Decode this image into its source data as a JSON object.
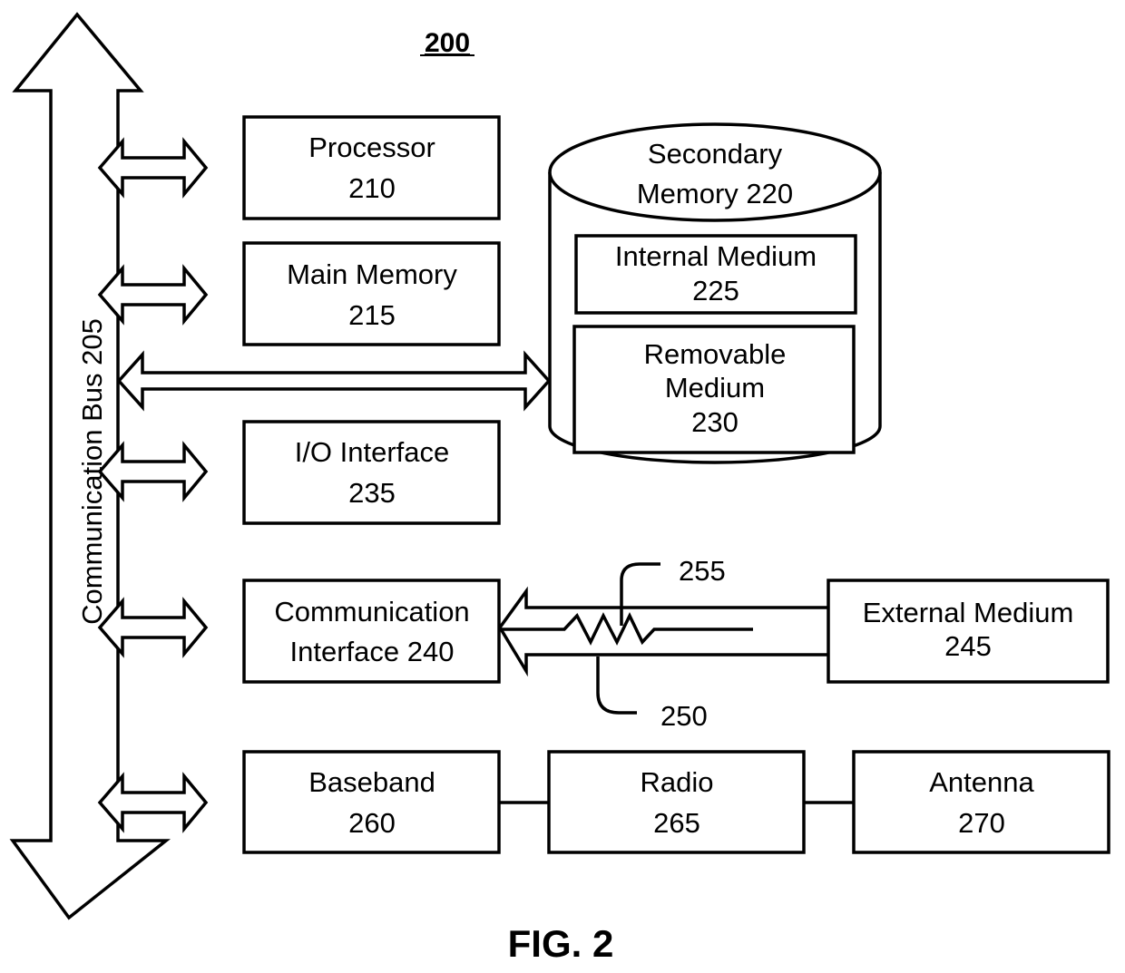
{
  "figure": {
    "number_label": "200",
    "caption": "FIG. 2"
  },
  "bus": {
    "label": "Communication Bus 205"
  },
  "blocks": {
    "processor": [
      "Processor",
      "210"
    ],
    "main_memory": [
      "Main Memory",
      "215"
    ],
    "io_interface": [
      "I/O Interface",
      "235"
    ],
    "comm_interface": [
      "Communication",
      "Interface 240"
    ],
    "baseband": [
      "Baseband",
      "260"
    ],
    "radio": [
      "Radio",
      "265"
    ],
    "antenna": [
      "Antenna",
      "270"
    ],
    "external_medium": [
      "External Medium",
      "245"
    ]
  },
  "secondary_memory": {
    "label": [
      "Secondary",
      "Memory 220"
    ],
    "internal_medium": [
      "Internal Medium",
      "225"
    ],
    "removable_medium": [
      "Removable",
      "Medium",
      "230"
    ]
  },
  "callouts": {
    "signal": "255",
    "channel": "250"
  }
}
